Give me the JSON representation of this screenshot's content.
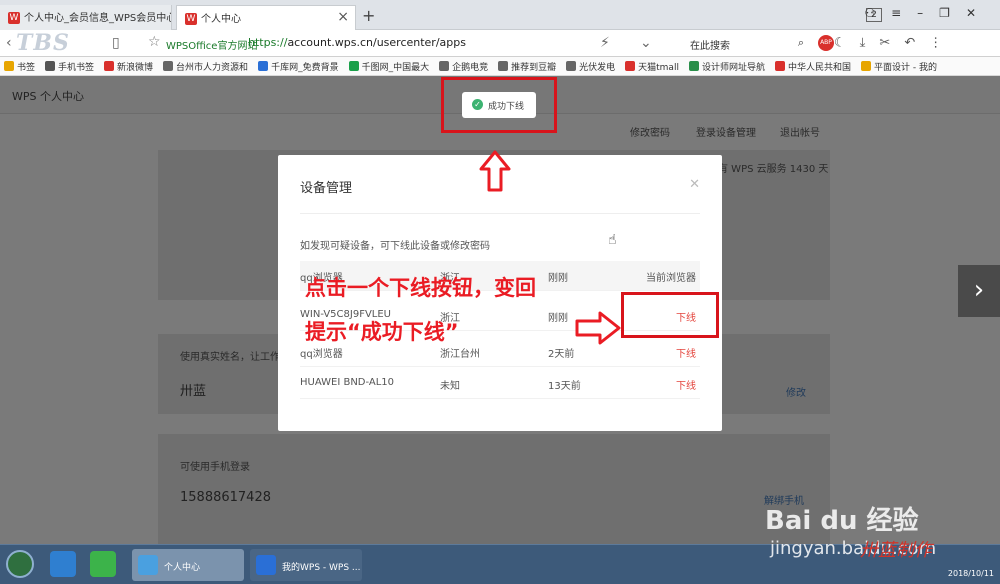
{
  "browser": {
    "tabs": [
      {
        "icon": "W",
        "title": "个人中心_会员信息_WPS会员中心,会"
      },
      {
        "icon": "W",
        "title": "个人中心"
      }
    ],
    "tab_count": "2",
    "logo_text": "TBS",
    "site_name": "WPSOffice官方网站",
    "url_scheme": "https://",
    "url_rest": "account.wps.cn/usercenter/apps",
    "search_placeholder": "在此搜索",
    "abp_label": "ABP",
    "bookmarks": [
      {
        "label": "书签",
        "color": "#e7a500"
      },
      {
        "label": "手机书签",
        "color": "#555555"
      },
      {
        "label": "新浪微博",
        "color": "#d9302c"
      },
      {
        "label": "台州市人力资源和",
        "color": "#666666"
      },
      {
        "label": "千库网_免费背景",
        "color": "#2a6fd6"
      },
      {
        "label": "千图网_中国最大",
        "color": "#1aa04a"
      },
      {
        "label": "企鹅电竞",
        "color": "#666666"
      },
      {
        "label": "推荐到豆瓣",
        "color": "#666666"
      },
      {
        "label": "光伏发电",
        "color": "#666666"
      },
      {
        "label": "天猫tmall",
        "color": "#d9302c"
      },
      {
        "label": "设计师网址导航",
        "color": "#2a8f4a"
      },
      {
        "label": "中华人民共和国",
        "color": "#d9302c"
      },
      {
        "label": "平面设计 - 我的",
        "color": "#e7a500"
      }
    ]
  },
  "page": {
    "title": "WPS 个人中心",
    "links": {
      "change_password": "修改密码",
      "login_devices": "登录设备管理",
      "logout": "退出帐号"
    },
    "cloud_info": "有 WPS 云服务 1430 天",
    "realname_hint": "使用真实姓名，让工作",
    "name": "卅蓝",
    "edit": "修改",
    "phone_hint": "可使用手机登录",
    "phone": "15888617428",
    "unbind_phone": "解绑手机"
  },
  "toast": {
    "text": "成功下线"
  },
  "modal": {
    "title": "设备管理",
    "hint": "如发现可疑设备，可下线此设备或修改密码",
    "rows": [
      {
        "device": "qq浏览器",
        "location": "浙江",
        "time": "刚刚",
        "action": "当前浏览器"
      },
      {
        "device": "WIN-V5C8J9FVLEU",
        "location": "浙江",
        "time": "刚刚",
        "action": "下线"
      },
      {
        "device": "qq浏览器",
        "location": "浙江台州",
        "time": "2天前",
        "action": "下线"
      },
      {
        "device": "HUAWEI BND-AL10",
        "location": "未知",
        "time": "13天前",
        "action": "下线"
      }
    ]
  },
  "annotation": {
    "line1": "点击一个下线按钮，变回",
    "line2": "提示“成功下线”",
    "color": "#ea1c24"
  },
  "taskbar": {
    "tasks": [
      {
        "label": "个人中心"
      },
      {
        "label": "我的WPS - WPS ..."
      }
    ],
    "date": "2018/10/11"
  },
  "watermark": {
    "baidu": "Bai du 经验",
    "site": "jingyan.baidu.com",
    "signature": "卅蓝制作"
  }
}
